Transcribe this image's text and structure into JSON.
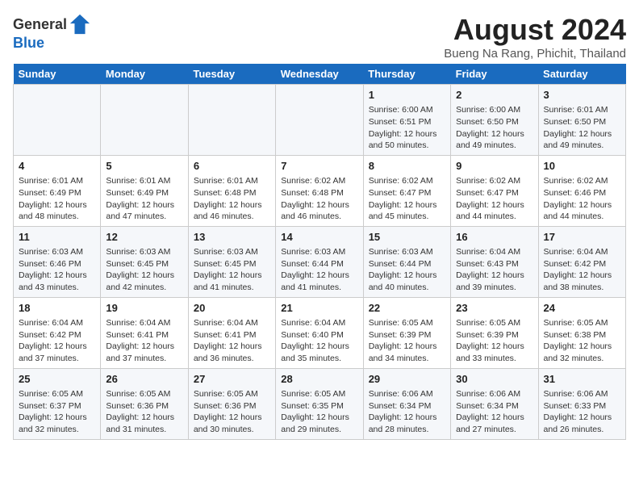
{
  "header": {
    "logo_general": "General",
    "logo_blue": "Blue",
    "title": "August 2024",
    "subtitle": "Bueng Na Rang, Phichit, Thailand"
  },
  "calendar": {
    "days_of_week": [
      "Sunday",
      "Monday",
      "Tuesday",
      "Wednesday",
      "Thursday",
      "Friday",
      "Saturday"
    ],
    "weeks": [
      [
        {
          "day": "",
          "info": ""
        },
        {
          "day": "",
          "info": ""
        },
        {
          "day": "",
          "info": ""
        },
        {
          "day": "",
          "info": ""
        },
        {
          "day": "1",
          "info": "Sunrise: 6:00 AM\nSunset: 6:51 PM\nDaylight: 12 hours and 50 minutes."
        },
        {
          "day": "2",
          "info": "Sunrise: 6:00 AM\nSunset: 6:50 PM\nDaylight: 12 hours and 49 minutes."
        },
        {
          "day": "3",
          "info": "Sunrise: 6:01 AM\nSunset: 6:50 PM\nDaylight: 12 hours and 49 minutes."
        }
      ],
      [
        {
          "day": "4",
          "info": "Sunrise: 6:01 AM\nSunset: 6:49 PM\nDaylight: 12 hours and 48 minutes."
        },
        {
          "day": "5",
          "info": "Sunrise: 6:01 AM\nSunset: 6:49 PM\nDaylight: 12 hours and 47 minutes."
        },
        {
          "day": "6",
          "info": "Sunrise: 6:01 AM\nSunset: 6:48 PM\nDaylight: 12 hours and 46 minutes."
        },
        {
          "day": "7",
          "info": "Sunrise: 6:02 AM\nSunset: 6:48 PM\nDaylight: 12 hours and 46 minutes."
        },
        {
          "day": "8",
          "info": "Sunrise: 6:02 AM\nSunset: 6:47 PM\nDaylight: 12 hours and 45 minutes."
        },
        {
          "day": "9",
          "info": "Sunrise: 6:02 AM\nSunset: 6:47 PM\nDaylight: 12 hours and 44 minutes."
        },
        {
          "day": "10",
          "info": "Sunrise: 6:02 AM\nSunset: 6:46 PM\nDaylight: 12 hours and 44 minutes."
        }
      ],
      [
        {
          "day": "11",
          "info": "Sunrise: 6:03 AM\nSunset: 6:46 PM\nDaylight: 12 hours and 43 minutes."
        },
        {
          "day": "12",
          "info": "Sunrise: 6:03 AM\nSunset: 6:45 PM\nDaylight: 12 hours and 42 minutes."
        },
        {
          "day": "13",
          "info": "Sunrise: 6:03 AM\nSunset: 6:45 PM\nDaylight: 12 hours and 41 minutes."
        },
        {
          "day": "14",
          "info": "Sunrise: 6:03 AM\nSunset: 6:44 PM\nDaylight: 12 hours and 41 minutes."
        },
        {
          "day": "15",
          "info": "Sunrise: 6:03 AM\nSunset: 6:44 PM\nDaylight: 12 hours and 40 minutes."
        },
        {
          "day": "16",
          "info": "Sunrise: 6:04 AM\nSunset: 6:43 PM\nDaylight: 12 hours and 39 minutes."
        },
        {
          "day": "17",
          "info": "Sunrise: 6:04 AM\nSunset: 6:42 PM\nDaylight: 12 hours and 38 minutes."
        }
      ],
      [
        {
          "day": "18",
          "info": "Sunrise: 6:04 AM\nSunset: 6:42 PM\nDaylight: 12 hours and 37 minutes."
        },
        {
          "day": "19",
          "info": "Sunrise: 6:04 AM\nSunset: 6:41 PM\nDaylight: 12 hours and 37 minutes."
        },
        {
          "day": "20",
          "info": "Sunrise: 6:04 AM\nSunset: 6:41 PM\nDaylight: 12 hours and 36 minutes."
        },
        {
          "day": "21",
          "info": "Sunrise: 6:04 AM\nSunset: 6:40 PM\nDaylight: 12 hours and 35 minutes."
        },
        {
          "day": "22",
          "info": "Sunrise: 6:05 AM\nSunset: 6:39 PM\nDaylight: 12 hours and 34 minutes."
        },
        {
          "day": "23",
          "info": "Sunrise: 6:05 AM\nSunset: 6:39 PM\nDaylight: 12 hours and 33 minutes."
        },
        {
          "day": "24",
          "info": "Sunrise: 6:05 AM\nSunset: 6:38 PM\nDaylight: 12 hours and 32 minutes."
        }
      ],
      [
        {
          "day": "25",
          "info": "Sunrise: 6:05 AM\nSunset: 6:37 PM\nDaylight: 12 hours and 32 minutes."
        },
        {
          "day": "26",
          "info": "Sunrise: 6:05 AM\nSunset: 6:36 PM\nDaylight: 12 hours and 31 minutes."
        },
        {
          "day": "27",
          "info": "Sunrise: 6:05 AM\nSunset: 6:36 PM\nDaylight: 12 hours and 30 minutes."
        },
        {
          "day": "28",
          "info": "Sunrise: 6:05 AM\nSunset: 6:35 PM\nDaylight: 12 hours and 29 minutes."
        },
        {
          "day": "29",
          "info": "Sunrise: 6:06 AM\nSunset: 6:34 PM\nDaylight: 12 hours and 28 minutes."
        },
        {
          "day": "30",
          "info": "Sunrise: 6:06 AM\nSunset: 6:34 PM\nDaylight: 12 hours and 27 minutes."
        },
        {
          "day": "31",
          "info": "Sunrise: 6:06 AM\nSunset: 6:33 PM\nDaylight: 12 hours and 26 minutes."
        }
      ]
    ]
  }
}
